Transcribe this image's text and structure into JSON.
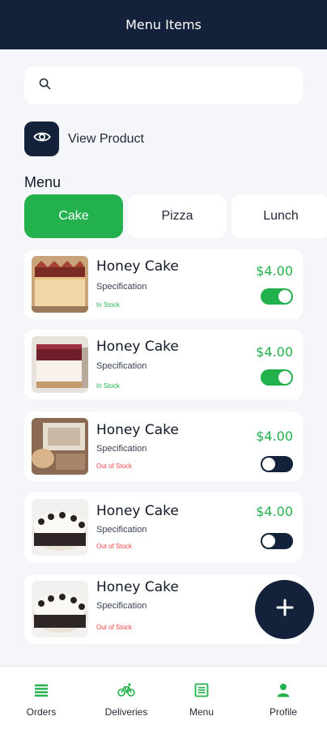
{
  "header": {
    "title": "Menu Items"
  },
  "search": {
    "placeholder": "",
    "value": ""
  },
  "view_product": {
    "label": "View Product"
  },
  "menu": {
    "heading": "Menu",
    "tabs": [
      {
        "label": "Cake",
        "active": true
      },
      {
        "label": "Pizza",
        "active": false
      },
      {
        "label": "Lunch",
        "active": false
      }
    ]
  },
  "items": [
    {
      "name": "Honey Cake",
      "spec": "Specification",
      "stock": "In Stock",
      "price": "$4.00",
      "available": true
    },
    {
      "name": "Honey Cake",
      "spec": "Specification",
      "stock": "In Stock",
      "price": "$4.00",
      "available": true
    },
    {
      "name": "Honey Cake",
      "spec": "Specification",
      "stock": "Out of Stock",
      "price": "$4.00",
      "available": false
    },
    {
      "name": "Honey Cake",
      "spec": "Specification",
      "stock": "Out of Stock",
      "price": "$4.00",
      "available": false
    },
    {
      "name": "Honey Cake",
      "spec": "Specification",
      "stock": "Out of Stock",
      "price": "",
      "available": false
    }
  ],
  "fab": {
    "icon": "plus-icon"
  },
  "nav": {
    "items": [
      {
        "label": "Orders",
        "icon": "list-icon"
      },
      {
        "label": "Deliveries",
        "icon": "bicycle-icon"
      },
      {
        "label": "Menu",
        "icon": "menu-book-icon"
      },
      {
        "label": "Profile",
        "icon": "person-icon"
      }
    ]
  },
  "colors": {
    "primary": "#22b14c",
    "dark": "#14213a",
    "danger": "#ef4444",
    "background": "#f5f6fa"
  }
}
